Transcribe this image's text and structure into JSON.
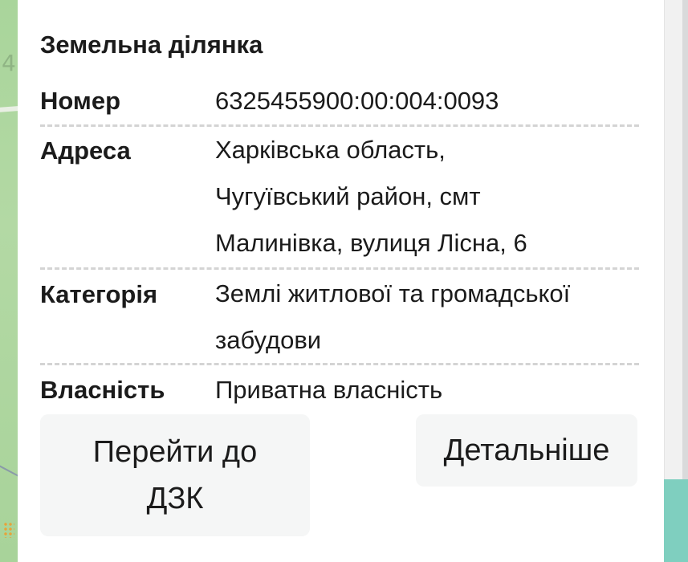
{
  "map": {
    "digit": "4"
  },
  "popup": {
    "title": "Земельна ділянка",
    "rows": [
      {
        "label": "Номер",
        "value": "6325455900:00:004:0093"
      },
      {
        "label": "Адреса",
        "value_lines": [
          "Харківська область,",
          "Чугуївський район, смт",
          "Малинівка, вулиця Лісна, 6"
        ]
      },
      {
        "label": "Категорія",
        "value_lines": [
          "Землі житлової та громадської",
          "забудови"
        ]
      },
      {
        "label": "Власність",
        "value": "Приватна власність"
      }
    ],
    "buttons": {
      "dzk_lines": [
        "Перейти до",
        "ДЗК"
      ],
      "more": "Детальніше"
    }
  },
  "colors": {
    "map_green": "#a8d39a",
    "accent_teal": "#7fcfbf",
    "button_bg": "#f5f6f6",
    "divider": "#d4d4d4"
  }
}
